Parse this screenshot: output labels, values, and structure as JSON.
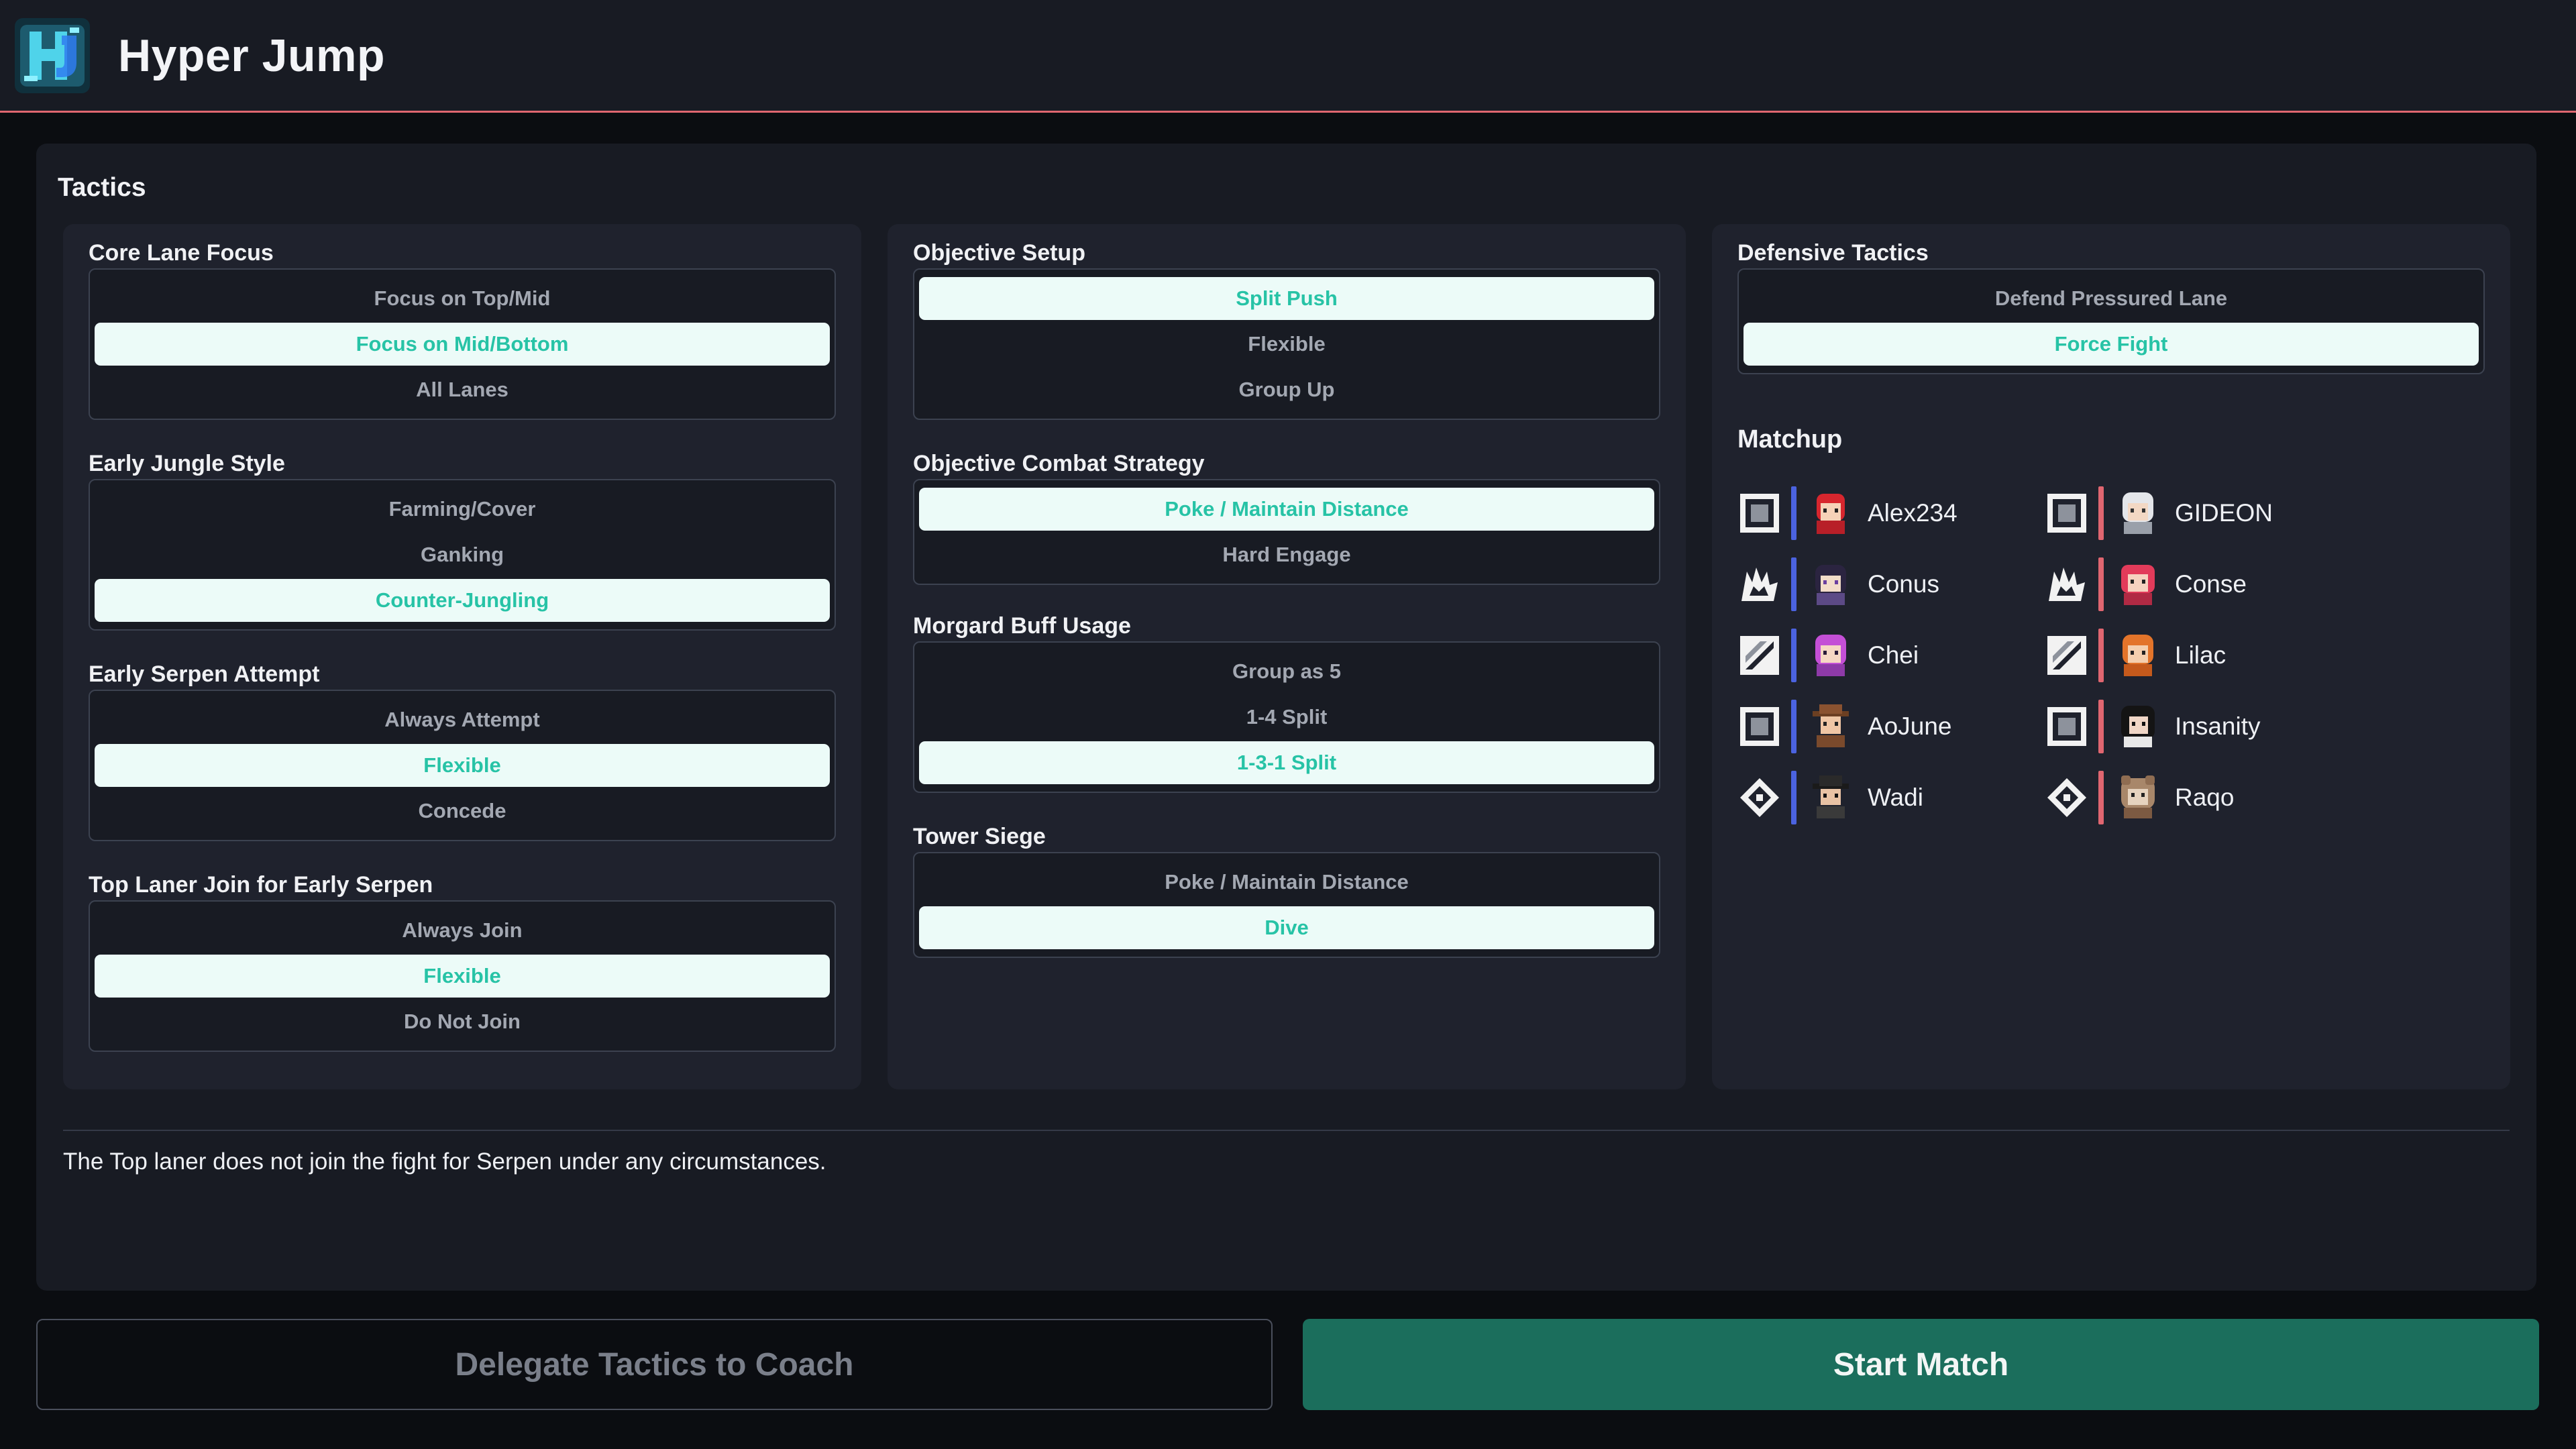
{
  "header": {
    "title": "Hyper Jump"
  },
  "tactics": {
    "title": "Tactics",
    "columns": [
      {
        "groups": [
          {
            "title": "Core Lane Focus",
            "options": [
              {
                "label": "Focus on Top/Mid",
                "selected": false
              },
              {
                "label": "Focus on Mid/Bottom",
                "selected": true
              },
              {
                "label": "All Lanes",
                "selected": false
              }
            ]
          },
          {
            "title": "Early Jungle Style",
            "options": [
              {
                "label": "Farming/Cover",
                "selected": false
              },
              {
                "label": "Ganking",
                "selected": false
              },
              {
                "label": "Counter-Jungling",
                "selected": true
              }
            ]
          },
          {
            "title": "Early Serpen Attempt",
            "options": [
              {
                "label": "Always Attempt",
                "selected": false
              },
              {
                "label": "Flexible",
                "selected": true
              },
              {
                "label": "Concede",
                "selected": false
              }
            ]
          },
          {
            "title": "Top Laner Join for Early Serpen",
            "options": [
              {
                "label": "Always Join",
                "selected": false
              },
              {
                "label": "Flexible",
                "selected": true
              },
              {
                "label": "Do Not Join",
                "selected": false
              }
            ]
          }
        ]
      },
      {
        "groups": [
          {
            "title": "Objective Setup",
            "options": [
              {
                "label": "Split Push",
                "selected": true
              },
              {
                "label": "Flexible",
                "selected": false
              },
              {
                "label": "Group Up",
                "selected": false
              }
            ]
          },
          {
            "title": "Objective Combat Strategy",
            "options": [
              {
                "label": "Poke / Maintain Distance",
                "selected": true
              },
              {
                "label": "Hard Engage",
                "selected": false
              }
            ]
          },
          {
            "title": "Morgard Buff Usage",
            "options": [
              {
                "label": "Group as 5",
                "selected": false
              },
              {
                "label": "1-4 Split",
                "selected": false
              },
              {
                "label": "1-3-1 Split",
                "selected": true
              }
            ]
          },
          {
            "title": "Tower Siege",
            "options": [
              {
                "label": "Poke / Maintain Distance",
                "selected": false
              },
              {
                "label": "Dive",
                "selected": true
              }
            ]
          }
        ]
      },
      {
        "groups": [
          {
            "title": "Defensive Tactics",
            "options": [
              {
                "label": "Defend Pressured Lane",
                "selected": false
              },
              {
                "label": "Force Fight",
                "selected": true
              }
            ]
          }
        ]
      }
    ]
  },
  "matchup": {
    "title": "Matchup",
    "blue_team": [
      {
        "role": "frame-icon",
        "name": "Alex234",
        "avatar": "red-hair-avatar"
      },
      {
        "role": "claw-icon",
        "name": "Conus",
        "avatar": "dark-hair-avatar"
      },
      {
        "role": "slash-icon",
        "name": "Chei",
        "avatar": "pink-hair-avatar"
      },
      {
        "role": "frame-icon",
        "name": "AoJune",
        "avatar": "hat-avatar"
      },
      {
        "role": "diamond-icon",
        "name": "Wadi",
        "avatar": "black-hat-avatar"
      }
    ],
    "red_team": [
      {
        "role": "frame-icon",
        "name": "GIDEON",
        "avatar": "white-hair-avatar"
      },
      {
        "role": "claw-icon",
        "name": "Conse",
        "avatar": "red-hair-avatar"
      },
      {
        "role": "slash-icon",
        "name": "Lilac",
        "avatar": "orange-hair-avatar"
      },
      {
        "role": "frame-icon",
        "name": "Insanity",
        "avatar": "black-hair-avatar"
      },
      {
        "role": "diamond-icon",
        "name": "Raqo",
        "avatar": "bear-avatar"
      }
    ]
  },
  "description": "The Top laner does not join the fight for Serpen under any circumstances.",
  "actions": {
    "delegate_label": "Delegate Tactics to Coach",
    "start_label": "Start Match"
  },
  "colors": {
    "accent": "#27c3a6",
    "selected_bg": "#ecfbf8",
    "blue_side": "#4b63e0",
    "red_side": "#e06670",
    "start_button": "#1b6e5c"
  }
}
